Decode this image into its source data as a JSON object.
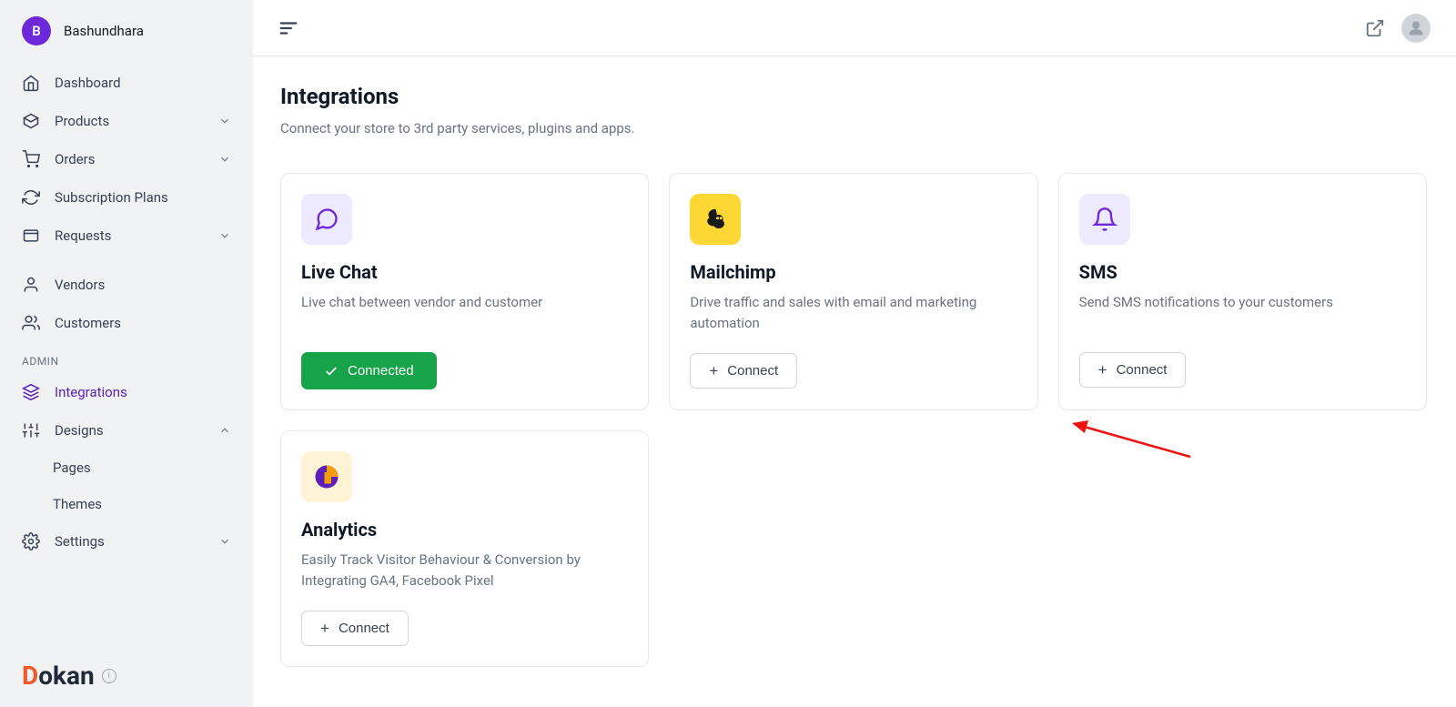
{
  "profile": {
    "initial": "B",
    "name": "Bashundhara"
  },
  "sidebar": {
    "items": [
      {
        "label": "Dashboard"
      },
      {
        "label": "Products"
      },
      {
        "label": "Orders"
      },
      {
        "label": "Subscription Plans"
      },
      {
        "label": "Requests"
      },
      {
        "label": "Vendors"
      },
      {
        "label": "Customers"
      }
    ],
    "admin_label": "ADMIN",
    "admin_items": [
      {
        "label": "Integrations"
      },
      {
        "label": "Designs"
      },
      {
        "label": "Pages"
      },
      {
        "label": "Themes"
      },
      {
        "label": "Settings"
      }
    ]
  },
  "brand": "Dokan",
  "page": {
    "title": "Integrations",
    "subtitle": "Connect your store to 3rd party services, plugins and apps."
  },
  "integrations": [
    {
      "title": "Live Chat",
      "desc": "Live chat between vendor and customer",
      "button": "Connected",
      "status": "connected"
    },
    {
      "title": "Mailchimp",
      "desc": "Drive traffic and sales with email and marketing automation",
      "button": "Connect",
      "status": "connect"
    },
    {
      "title": "SMS",
      "desc": "Send SMS notifications to your customers",
      "button": "Connect",
      "status": "connect"
    },
    {
      "title": "Analytics",
      "desc": "Easily Track Visitor Behaviour & Conversion by Integrating GA4, Facebook Pixel",
      "button": "Connect",
      "status": "connect"
    }
  ]
}
